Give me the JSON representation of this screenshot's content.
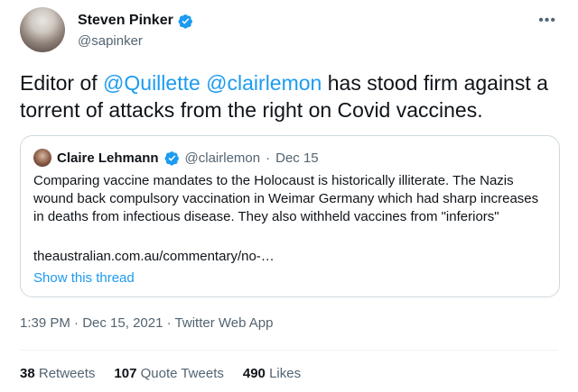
{
  "author": {
    "name": "Steven Pinker",
    "handle": "@sapinker"
  },
  "tweet": {
    "text_part1": "Editor of ",
    "mention1": "@Quillette",
    "text_part2": " ",
    "mention2": "@clairlemon",
    "text_part3": " has stood firm against a torrent of attacks from the right on Covid vaccines."
  },
  "quoted": {
    "name": "Claire Lehmann",
    "handle": "@clairlemon",
    "separator": "·",
    "date": "Dec 15",
    "text": "Comparing vaccine mandates to the Holocaust is historically illiterate. The Nazis wound back compulsory vaccination in Weimar Germany which had sharp increases in deaths from infectious disease. They also withheld vaccines from \"inferiors\"",
    "link": "theaustralian.com.au/commentary/no-…",
    "show_thread": "Show this thread"
  },
  "meta": {
    "time": "1:39 PM",
    "date": "Dec 15, 2021",
    "source": "Twitter Web App",
    "separator": "·"
  },
  "stats": {
    "retweets_count": "38",
    "retweets_label": "Retweets",
    "quotes_count": "107",
    "quotes_label": "Quote Tweets",
    "likes_count": "490",
    "likes_label": "Likes"
  },
  "more_glyph": "•••",
  "colors": {
    "accent": "#1d9bf0",
    "muted": "#536471",
    "text": "#0f1419",
    "border": "#cfd9de"
  },
  "icons": [
    "verified-badge-icon",
    "more-options-icon"
  ]
}
